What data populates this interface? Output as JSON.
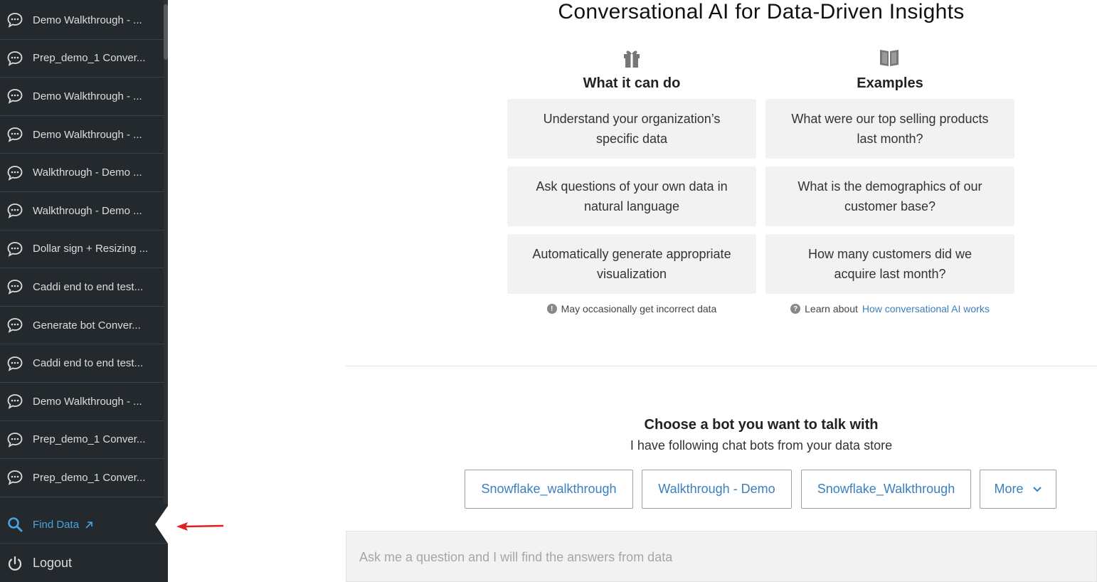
{
  "sidebar": {
    "conversations": [
      "Demo Walkthrough - ...",
      "Prep_demo_1 Conver...",
      "Demo Walkthrough - ...",
      "Demo Walkthrough - ...",
      "Walkthrough - Demo ...",
      "Walkthrough - Demo ...",
      "Dollar sign + Resizing ...",
      "Caddi end to end test...",
      "Generate bot Conver...",
      "Caddi end to end test...",
      "Demo Walkthrough - ...",
      "Prep_demo_1 Conver...",
      "Prep_demo_1 Conver..."
    ],
    "find_data": "Find Data",
    "logout": "Logout"
  },
  "main": {
    "title": "Conversational AI for Data-Driven Insights",
    "capabilities": {
      "heading": "What it can do",
      "icon": "gift-icon",
      "cards": [
        "Understand your organization’s specific data",
        "Ask questions of your own data in natural language",
        "Automatically generate appropriate visualization"
      ],
      "note": "May occasionally get incorrect data"
    },
    "examples": {
      "heading": "Examples",
      "icon": "book-icon",
      "cards": [
        "What were our top selling products last month?",
        "What is the demographics of our customer base?",
        "How many customers did we acquire last month?"
      ],
      "note_prefix": "Learn about",
      "note_link": "How conversational AI works"
    },
    "choose": {
      "title": "Choose a bot you want to talk with",
      "subtitle": "I have following chat bots from your data store",
      "bots": [
        "Snowflake_walkthrough",
        "Walkthrough - Demo",
        "Snowflake_Walkthrough"
      ],
      "more": "More"
    },
    "ask_placeholder": "Ask me a question and I will find the answers from data"
  },
  "colors": {
    "sidebar_bg": "#23292d",
    "link": "#3a7fc0",
    "find_data": "#4aa3df",
    "arrow": "#e02020"
  }
}
